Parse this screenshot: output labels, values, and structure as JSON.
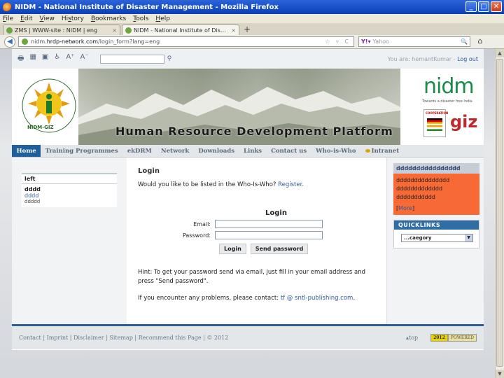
{
  "window": {
    "title": "NIDM - National Institute of Disaster Management - Mozilla Firefox",
    "minimize": "_",
    "maximize": "□",
    "close": "✕"
  },
  "menubar": {
    "items": [
      {
        "u": "F",
        "rest": "ile"
      },
      {
        "u": "E",
        "rest": "dit"
      },
      {
        "u": "V",
        "rest": "iew"
      },
      {
        "pre": "Hi",
        "u": "s",
        "rest": "tory"
      },
      {
        "u": "B",
        "rest": "ookmarks"
      },
      {
        "u": "T",
        "rest": "ools"
      },
      {
        "u": "H",
        "rest": "elp"
      }
    ]
  },
  "tabs": [
    {
      "label": "ZMS | WWW-site : NIDM | eng",
      "close": "×"
    },
    {
      "label": "NIDM - National Institute of Disaster Man...",
      "close": "×"
    }
  ],
  "newtab": "+",
  "navbar": {
    "back": "◀",
    "url_prefix": "nidm.",
    "url_host": "hrdp-network.com",
    "url_path": "/login_form?lang=eng",
    "url_controls": "☆ ▿ C",
    "search_engine": "Y!▾",
    "search_placeholder": "Yahoo",
    "search_icon": "🔍",
    "home": "⌂"
  },
  "site": {
    "tool_icons": [
      "🖶",
      "▦",
      "▣",
      "♿",
      "A⁺",
      "A⁻"
    ],
    "user_prefix": "You are: hemantKumar - ",
    "logout": "Log out",
    "banner_title": "Human Resource Development Platform",
    "left_logo_text": "NIDM-GIZ",
    "nidm_logo": "nidm",
    "nidm_tagline": "Towards a disaster free India",
    "coop_label": "COOPERATION",
    "giz_logo": "giz",
    "nav": [
      "Home",
      "Training Programmes",
      "ekDRM",
      "Network",
      "Downloads",
      "Links",
      "Contact us",
      "Who-is-Who",
      "Intranet"
    ]
  },
  "leftbox": {
    "head": "left",
    "row1": "dddd",
    "row2": "dddd",
    "row3": "ddddd"
  },
  "main": {
    "heading": "Login",
    "register_text": "Would you like to be listed in the Who-Is-Who? ",
    "register_link": "Register",
    "register_end": ".",
    "form_title": "Login",
    "email_label": "Email:",
    "password_label": "Password:",
    "login_button": "Login",
    "send_button": "Send password",
    "hint": "Hint: To get your password send via email, just fill in your email address and press \"Send password\".",
    "contact_text": "If you encounter any problems, please contact: ",
    "contact_email": "tf @ sntl-publishing.com",
    "contact_end": "."
  },
  "rightbox": {
    "head": "dddddddddddddddd",
    "lines": [
      "ddddddddddddddd",
      "ddddddddddddd",
      "ddddddddddd"
    ],
    "more_open": "[",
    "more": "More",
    "more_close": "]"
  },
  "quicklinks": {
    "head": "QUICKLINKS",
    "selected": "...caegory",
    "arrow": "▼"
  },
  "footer": {
    "links": [
      "Contact",
      "Imprint",
      "Disclaimer",
      "Sitemap",
      "Recommend this Page",
      "© 2012"
    ],
    "top": "▴top",
    "badge_year": "2012",
    "badge_powered": "POWERED"
  },
  "scrollbar": {
    "up": "▲",
    "down": "▼"
  }
}
